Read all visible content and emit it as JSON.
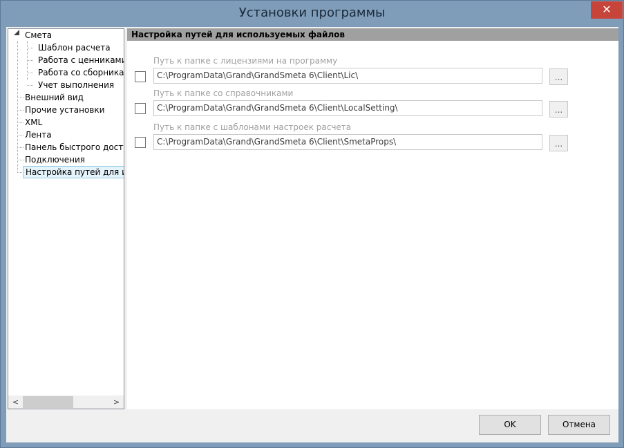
{
  "window": {
    "title": "Установки программы",
    "close_glyph": "✕"
  },
  "tree": {
    "items": [
      {
        "label": "Смета"
      },
      {
        "label": "Шаблон расчета"
      },
      {
        "label": "Работа с ценниками"
      },
      {
        "label": "Работа со сборниками"
      },
      {
        "label": "Учет выполнения"
      },
      {
        "label": "Внешний вид"
      },
      {
        "label": "Прочие установки"
      },
      {
        "label": "XML"
      },
      {
        "label": "Лента"
      },
      {
        "label": "Панель быстрого доступа"
      },
      {
        "label": "Подключения"
      },
      {
        "label": "Настройка путей для используемых файлов"
      }
    ],
    "selected_index": 11,
    "scroll_left_glyph": "<",
    "scroll_right_glyph": ">"
  },
  "panel": {
    "header": "Настройка путей для используемых файлов",
    "paths": [
      {
        "label": "Путь к папке с лицензиями на программу",
        "value": "C:\\ProgramData\\Grand\\GrandSmeta 6\\Client\\Lic\\",
        "checked": false,
        "browse_label": "..."
      },
      {
        "label": "Путь к папке со справочниками",
        "value": "C:\\ProgramData\\Grand\\GrandSmeta 6\\Client\\LocalSetting\\",
        "checked": false,
        "browse_label": "..."
      },
      {
        "label": "Путь к папке с шаблонами настроек расчета",
        "value": "C:\\ProgramData\\Grand\\GrandSmeta 6\\Client\\SmetaProps\\",
        "checked": false,
        "browse_label": "..."
      }
    ]
  },
  "buttons": {
    "ok": "OK",
    "cancel": "Отмена"
  },
  "colors": {
    "titlebar": "#7f9db9",
    "close": "#c7443a",
    "selection": "#e5f3fb"
  }
}
